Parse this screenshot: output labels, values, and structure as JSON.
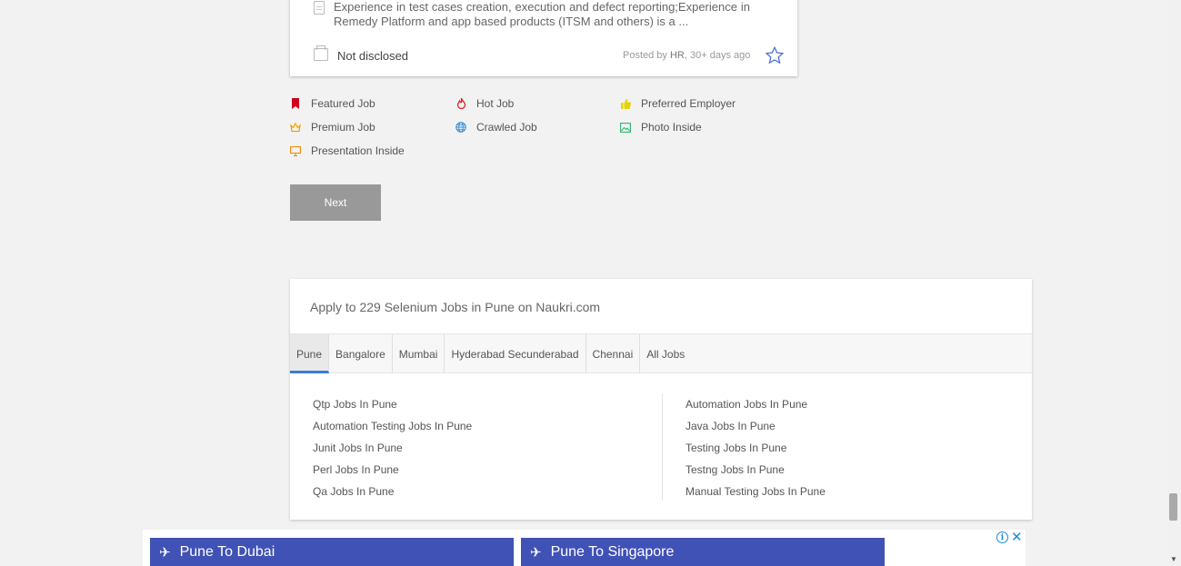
{
  "job_card": {
    "description": "Experience in test cases creation, execution and defect reporting;Experience in Remedy Platform and app based products (ITSM and others) is a ...",
    "salary": "Not disclosed",
    "posted_prefix": "Posted by",
    "posted_by": "HR",
    "posted_suffix": ", 30+ days ago"
  },
  "legend": {
    "featured": "Featured Job",
    "hot": "Hot Job",
    "preferred": "Preferred Employer",
    "premium": "Premium Job",
    "crawled": "Crawled Job",
    "photo": "Photo Inside",
    "presentation": "Presentation Inside"
  },
  "pagination": {
    "next_label": "Next"
  },
  "related": {
    "title": "Apply to 229 Selenium Jobs in Pune on Naukri.com",
    "tabs": [
      "Pune",
      "Bangalore",
      "Mumbai",
      "Hyderabad Secunderabad",
      "Chennai",
      "All Jobs"
    ],
    "active_tab": "Pune",
    "left_links": [
      "Qtp Jobs In Pune",
      "Automation Testing Jobs In Pune",
      "Junit Jobs In Pune",
      "Perl Jobs In Pune",
      "Qa Jobs In Pune"
    ],
    "right_links": [
      "Automation Jobs In Pune",
      "Java Jobs In Pune",
      "Testing Jobs In Pune",
      "Testng Jobs In Pune",
      "Manual Testing Jobs In Pune"
    ]
  },
  "ad": {
    "btn1": "Pune To Dubai",
    "btn2": "Pune To Singapore",
    "info_glyph": "i",
    "close_glyph": "✕"
  },
  "colors": {
    "accent": "#3a7bd5",
    "ad_blue": "#4052b5",
    "button_grey": "#999999"
  }
}
